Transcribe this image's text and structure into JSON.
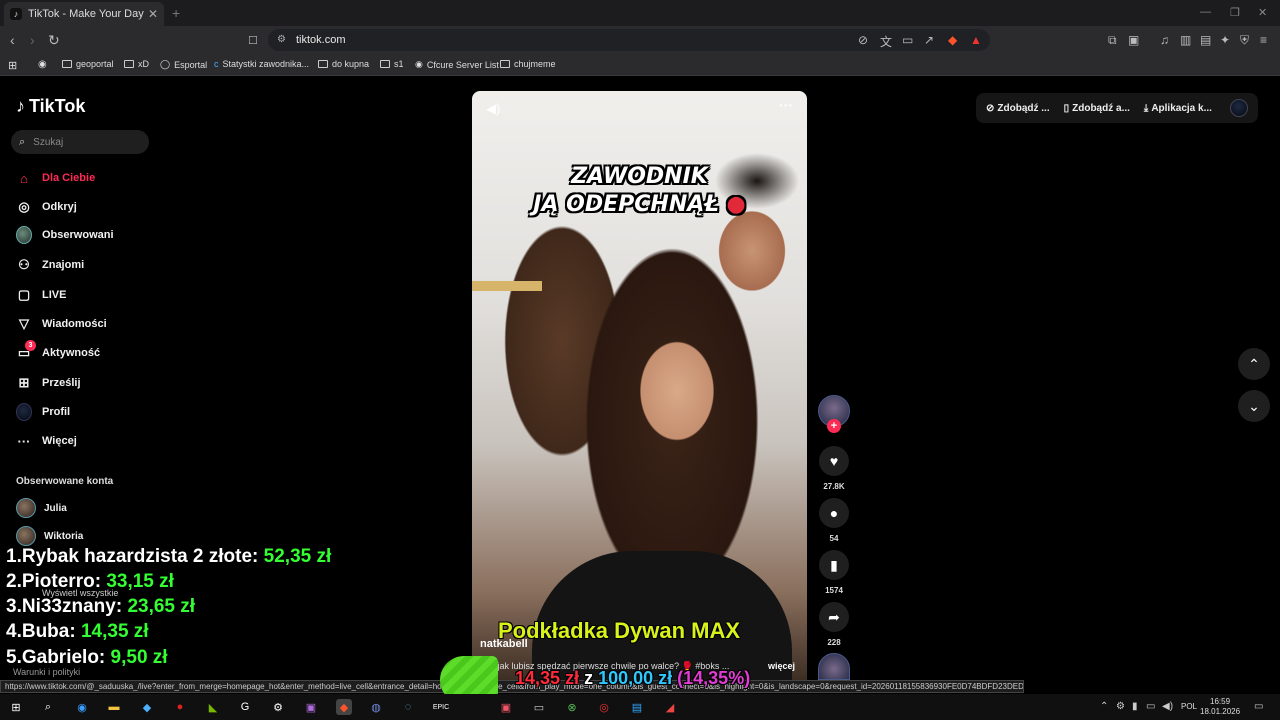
{
  "browser": {
    "tab_title": "TikTok - Make Your Day",
    "url": "tiktok.com",
    "bookmarks": [
      "geoportal",
      "xD",
      "Esportal",
      "Statystki zawodnika...",
      "do kupna",
      "s1",
      "Cfcure Server List",
      "chujmeme"
    ]
  },
  "sidebar": {
    "logo": "TikTok",
    "search_placeholder": "Szukaj",
    "nav": [
      {
        "label": "Dla Ciebie",
        "icon": "home-icon"
      },
      {
        "label": "Odkryj",
        "icon": "compass-icon"
      },
      {
        "label": "Obserwowani",
        "icon": "avatar-icon"
      },
      {
        "label": "Znajomi",
        "icon": "friends-icon"
      },
      {
        "label": "LIVE",
        "icon": "live-icon"
      },
      {
        "label": "Wiadomości",
        "icon": "messages-icon"
      },
      {
        "label": "Aktywność",
        "icon": "activity-icon",
        "badge": "3"
      },
      {
        "label": "Prześlij",
        "icon": "upload-icon"
      },
      {
        "label": "Profil",
        "icon": "profile-icon"
      },
      {
        "label": "Więcej",
        "icon": "more-icon"
      }
    ],
    "followed_title": "Obserwowane konta",
    "followed": [
      "Julia",
      "Wiktoria"
    ],
    "show_all": "Wyświetl wszystkie",
    "terms": "Warunki i polityki"
  },
  "topright": {
    "item1": "Zdobądź ...",
    "item2": "Zdobądź a...",
    "item3": "Aplikacja k..."
  },
  "video": {
    "caption_line1": "ZAWODNIK",
    "caption_line2": "JĄ ODEPCHNĄŁ",
    "username": "natkabell",
    "description": "A ty jak lubisz spędzać pierwsze chwile po walce? 🥊 #boks ...",
    "more": "więcej"
  },
  "actions": {
    "likes": "27.8K",
    "comments": "54",
    "saves": "1574",
    "shares": "228"
  },
  "leaderboard": [
    {
      "rank": "1.",
      "name": "Rybak hazardzista 2 złote:",
      "amount": "52,35 zł"
    },
    {
      "rank": "2.",
      "name": "Pioterro:",
      "amount": "33,15 zł"
    },
    {
      "rank": "3.",
      "name": "Ni33znany:",
      "amount": "23,65 zł"
    },
    {
      "rank": "4.",
      "name": "Buba:",
      "amount": "14,35 zł"
    },
    {
      "rank": "5.",
      "name": "Gabrielo:",
      "amount": "9,50 zł"
    }
  ],
  "sponsor": "Podkładka Dywan MAX",
  "goal": {
    "current": "14,35 zł",
    "sep": "z",
    "total": "100,00 zł",
    "percent": "(14,35%)"
  },
  "status_url": "https://www.tiktok.com/@_saduuska_/live?enter_from_merge=homepage_hot&enter_method=live_cell&entrance_detail=homepage_hot_live_cell&from_play_mode=one_column&is_guest_connect=0&is_highlight=0&is_landscape=0&request_id=20260118155836930FE0D74BDFD23DED59",
  "taskbar": {
    "lang": "POL",
    "time": "16:59",
    "date": "18.01.2026"
  }
}
